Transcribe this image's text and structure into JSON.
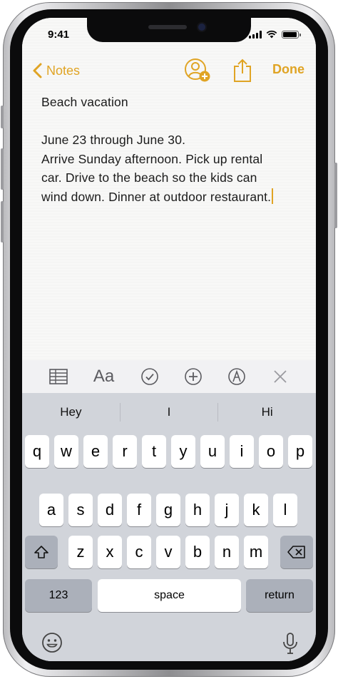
{
  "status_bar": {
    "time": "9:41"
  },
  "nav": {
    "back_label": "Notes",
    "done_label": "Done"
  },
  "note": {
    "title": "Beach vacation",
    "lines": [
      "June 23 through June 30.",
      "Arrive Sunday afternoon. Pick up rental",
      "car. Drive to the beach so the kids can",
      "wind down. Dinner at outdoor restaurant."
    ]
  },
  "toolbar": {
    "format_label": "Aa"
  },
  "keyboard": {
    "suggestions": [
      "Hey",
      "I",
      "Hi"
    ],
    "row1": [
      "q",
      "w",
      "e",
      "r",
      "t",
      "y",
      "u",
      "i",
      "o",
      "p"
    ],
    "row2": [
      "a",
      "s",
      "d",
      "f",
      "g",
      "h",
      "j",
      "k",
      "l"
    ],
    "row3": [
      "z",
      "x",
      "c",
      "v",
      "b",
      "n",
      "m"
    ],
    "numbers_label": "123",
    "space_label": "space",
    "return_label": "return"
  },
  "colors": {
    "accent": "#e0a424",
    "keyboard_bg": "#d1d4da",
    "dark_key": "#abb0ba"
  },
  "icons": [
    "back-chevron",
    "add-person",
    "share",
    "table",
    "checklist",
    "plus",
    "markup",
    "close",
    "shift",
    "delete",
    "emoji",
    "microphone"
  ]
}
